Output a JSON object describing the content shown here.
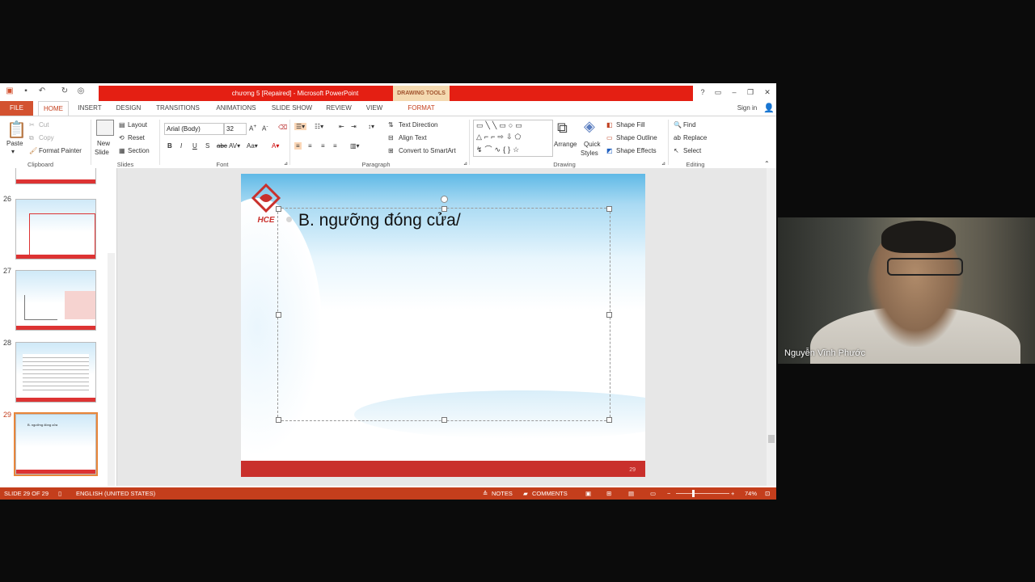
{
  "window": {
    "title": "chương 5 [Repaired] -  Microsoft PowerPoint",
    "context_tab": "DRAWING TOOLS",
    "sign_in": "Sign in"
  },
  "tabs": [
    "FILE",
    "HOME",
    "INSERT",
    "DESIGN",
    "TRANSITIONS",
    "ANIMATIONS",
    "SLIDE SHOW",
    "REVIEW",
    "VIEW",
    "FORMAT"
  ],
  "ribbon": {
    "clipboard": {
      "paste": "Paste",
      "cut": "Cut",
      "copy": "Copy",
      "format_painter": "Format Painter",
      "label": "Clipboard"
    },
    "slides": {
      "new_slide_1": "New",
      "new_slide_2": "Slide",
      "layout": "Layout",
      "reset": "Reset",
      "section": "Section",
      "label": "Slides"
    },
    "font": {
      "name": "Arial (Body)",
      "size": "32",
      "label": "Font"
    },
    "paragraph": {
      "text_direction": "Text Direction",
      "align_text": "Align Text",
      "smartart": "Convert to SmartArt",
      "label": "Paragraph"
    },
    "drawing": {
      "arrange": "Arrange",
      "quick_styles_1": "Quick",
      "quick_styles_2": "Styles",
      "shape_fill": "Shape Fill",
      "shape_outline": "Shape Outline",
      "shape_effects": "Shape Effects",
      "label": "Drawing"
    },
    "editing": {
      "find": "Find",
      "replace": "Replace",
      "select": "Select",
      "label": "Editing"
    }
  },
  "thumbnails": [
    {
      "num": "26"
    },
    {
      "num": "27"
    },
    {
      "num": "28"
    },
    {
      "num": "29",
      "selected": true,
      "text": "B. ngưỡng đóng cửa"
    }
  ],
  "slide": {
    "logo_text": "HCE",
    "body_text": "B. ngưỡng đóng cửa/",
    "slide_number": "29"
  },
  "status": {
    "slide": "SLIDE 29 OF 29",
    "language": "ENGLISH (UNITED STATES)",
    "notes": "NOTES",
    "comments": "COMMENTS",
    "zoom": "74%"
  },
  "webcam": {
    "name": "Nguyễn Vĩnh Phước"
  }
}
